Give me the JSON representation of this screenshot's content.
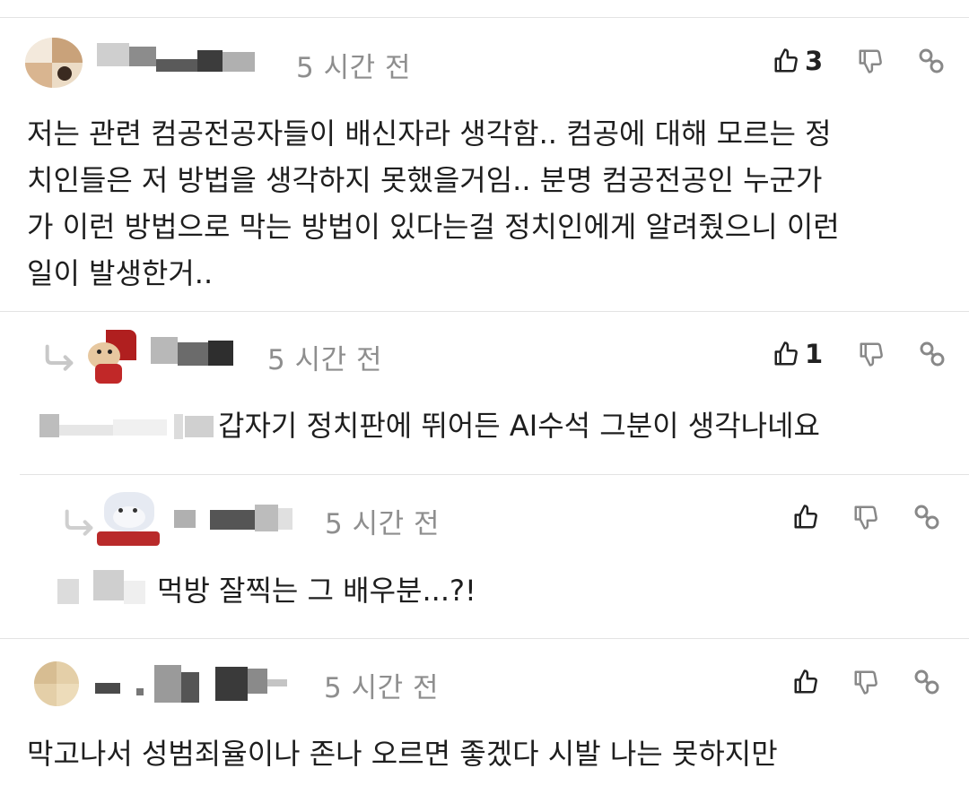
{
  "comments": [
    {
      "time": "5 시간 전",
      "likes": "3",
      "text": "저는 관련 컴공전공자들이 배신자라 생각함.. 컴공에 대해 모르는 정\n치인들은 저 방법을 생각하지 못했을거임.. 분명 컴공전공인 누군가\n가 이런 방법으로 막는 방법이 있다는걸 정치인에게 알려줬으니 이런\n일이 발생한거.."
    },
    {
      "time": "5 시간 전",
      "likes": "1",
      "text": "갑자기 정치판에 뛰어든 AI수석 그분이 생각나네요"
    },
    {
      "time": "5 시간 전",
      "likes": "",
      "text": "먹방 잘찍는 그 배우분...?!"
    },
    {
      "time": "5 시간 전",
      "likes": "",
      "text": "막고나서 성범죄율이나 존나 오르면 좋겠다 시발 나는 못하지만"
    }
  ],
  "icons": {
    "like": "thumbs-up-icon",
    "dislike": "thumbs-down-icon",
    "link": "link-icon",
    "reply": "reply-arrow-icon"
  },
  "colors": {
    "text": "#1e1e1e",
    "meta": "#8e8e8e",
    "icon": "#555555",
    "divider": "#e3e3e3"
  }
}
